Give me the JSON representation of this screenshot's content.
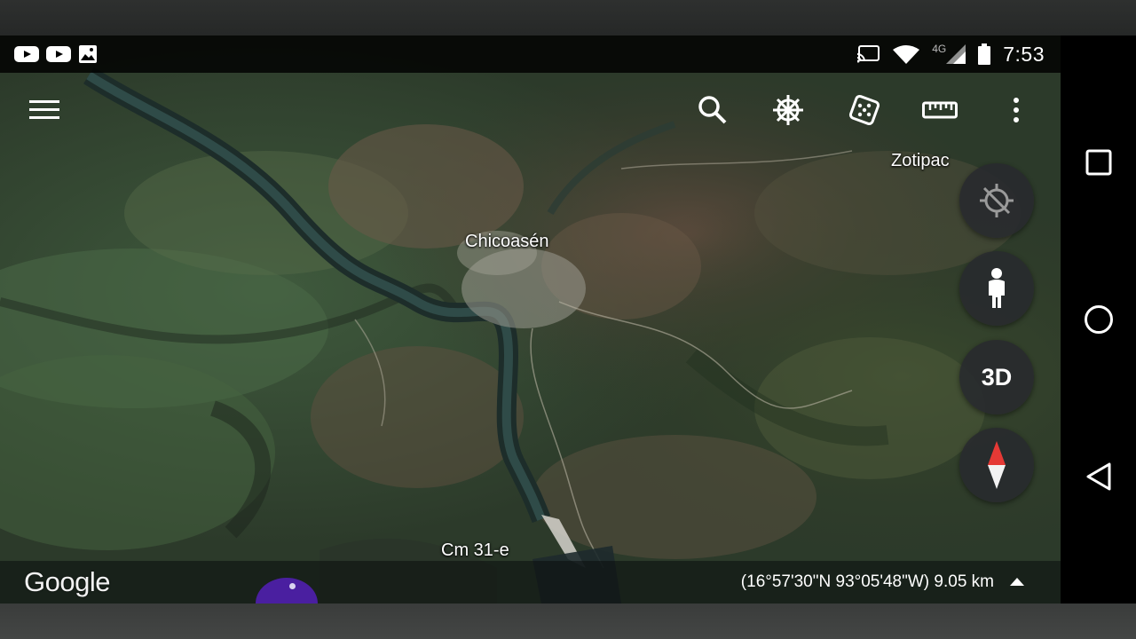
{
  "status_bar": {
    "time": "7:53",
    "network_type": "4G",
    "left_icons": [
      "youtube-icon",
      "youtube-icon",
      "image-icon"
    ],
    "right_icons": [
      "cast-icon",
      "wifi-icon",
      "cell-signal-icon",
      "battery-icon"
    ]
  },
  "toolbar": {
    "menu_icon": "hamburger-menu-icon",
    "actions": [
      "search-icon",
      "voyager-wheel-icon",
      "feeling-lucky-dice-icon",
      "measure-ruler-icon",
      "more-options-icon"
    ]
  },
  "map": {
    "labels": {
      "town_main": "Chicoasén",
      "town_secondary": "Zotipac",
      "road": "Cm 31-e"
    }
  },
  "controls": {
    "location_icon": "location-disabled-icon",
    "street_view_icon": "pegman-icon",
    "toggle_3d": "3D",
    "compass_icon": "compass-icon"
  },
  "bottom_bar": {
    "brand": "Google",
    "coordinates_scale": "(16°57'30\"N 93°05'48\"W) 9.05 km",
    "expand_icon": "expand-up-icon"
  },
  "android_nav": [
    "recents-square-icon",
    "home-circle-icon",
    "back-triangle-icon"
  ],
  "colors": {
    "fab_background": "#2a2c2f",
    "compass_red": "#e53935",
    "status_bar": "#000000",
    "cursor_highlight": "#4a1fa0"
  }
}
